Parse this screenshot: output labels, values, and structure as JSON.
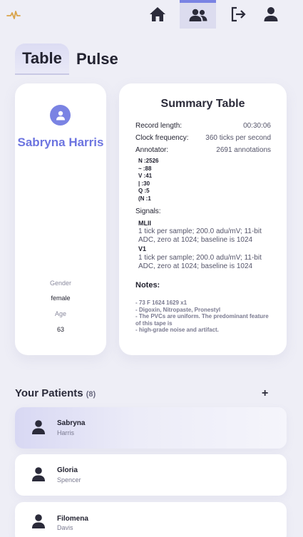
{
  "nav": {
    "logo_icon": "pulse-icon",
    "items": [
      "home-icon",
      "patients-icon",
      "logout-icon",
      "profile-icon"
    ],
    "accent": "#7a83e3"
  },
  "tabs": [
    {
      "label": "Table",
      "active": true
    },
    {
      "label": "Pulse",
      "active": false
    }
  ],
  "patient": {
    "name": "Sabryna Harris",
    "gender_label": "Gender",
    "gender": "female",
    "age_label": "Age",
    "age": "63"
  },
  "summary": {
    "title": "Summary Table",
    "record_length_label": "Record length:",
    "record_length": "00:30:06",
    "clock_frequency_label": "Clock frequency:",
    "clock_frequency": "360 ticks per second",
    "annotator_label": "Annotator:",
    "annotator": "2691 annotations",
    "annotations": [
      "N :2526",
      "~ :88",
      "V :41",
      "| :30",
      "Q :5",
      "(N :1"
    ],
    "signals_label": "Signals:",
    "signals": [
      {
        "name": "MLII",
        "desc": "1 tick per sample; 200.0 adu/mV; 11-bit ADC, zero at 1024; baseline is 1024"
      },
      {
        "name": "V1",
        "desc": "1 tick per sample; 200.0 adu/mV; 11-bit ADC, zero at 1024; baseline is 1024"
      }
    ],
    "notes_label": "Notes:",
    "notes": [
      "- 73 F 1624 1629 x1",
      "- Digoxin, Nitropaste, Pronestyl",
      "- The PVCs are uniform. The predominant feature of this tape is",
      "- high-grade noise and artifact."
    ]
  },
  "patients_list": {
    "title": "Your Patients",
    "count": "(8)",
    "add_label": "+",
    "items": [
      {
        "first": "Sabryna",
        "last": "Harris",
        "selected": true
      },
      {
        "first": "Gloria",
        "last": "Spencer",
        "selected": false
      },
      {
        "first": "Filomena",
        "last": "Davis",
        "selected": false
      }
    ]
  }
}
